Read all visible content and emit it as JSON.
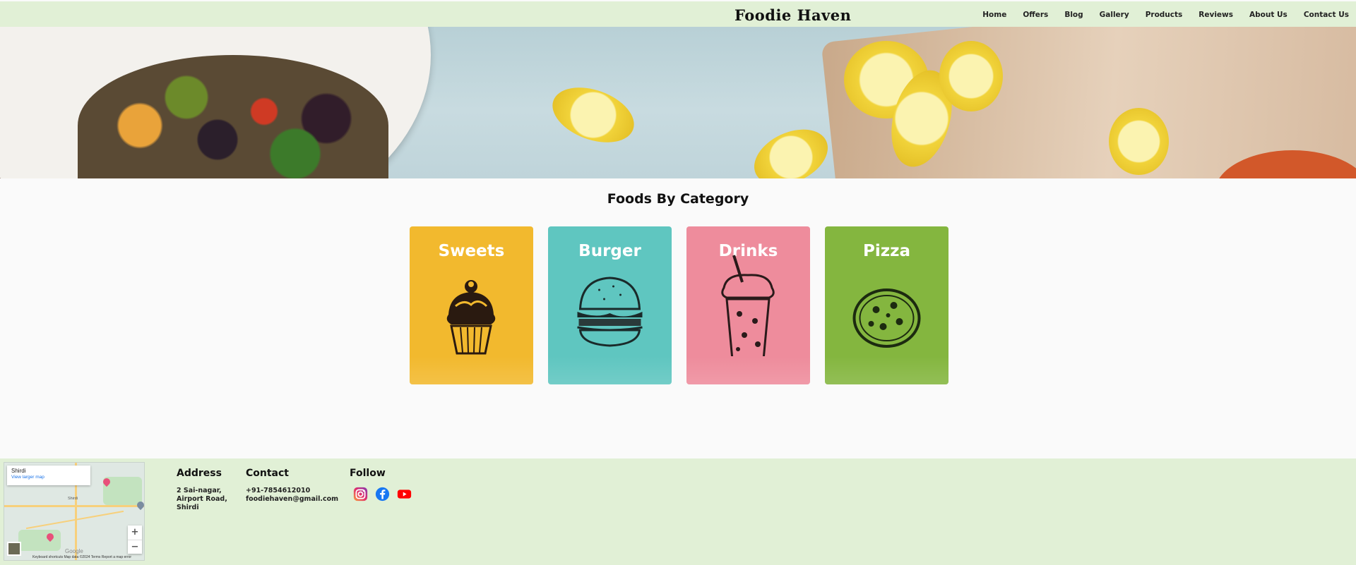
{
  "header": {
    "brand": "Foodie Haven",
    "nav": [
      "Home",
      "Offers",
      "Blog",
      "Gallery",
      "Products",
      "Reviews",
      "About Us",
      "Contact Us"
    ]
  },
  "categories": {
    "title": "Foods By Category",
    "items": [
      {
        "label": "Sweets",
        "color": "#f2b92e",
        "icon": "cupcake-icon"
      },
      {
        "label": "Burger",
        "color": "#5fc6c0",
        "icon": "burger-icon"
      },
      {
        "label": "Drinks",
        "color": "#ee8c9c",
        "icon": "milkshake-icon"
      },
      {
        "label": "Pizza",
        "color": "#84b63f",
        "icon": "pizza-icon"
      }
    ]
  },
  "footer": {
    "map": {
      "place": "Shirdi",
      "view_larger": "View larger map",
      "attribution": "Keyboard shortcuts    Map data ©2024    Terms    Report a map error"
    },
    "address": {
      "heading": "Address",
      "lines": [
        "2 Sai-nagar,",
        "Airport Road,",
        "Shirdi"
      ]
    },
    "contact": {
      "heading": "Contact",
      "phone": "+91-7854612010",
      "email": "foodiehaven@gmail.com"
    },
    "follow": {
      "heading": "Follow",
      "icons": [
        "instagram-icon",
        "facebook-icon",
        "youtube-icon"
      ]
    }
  }
}
